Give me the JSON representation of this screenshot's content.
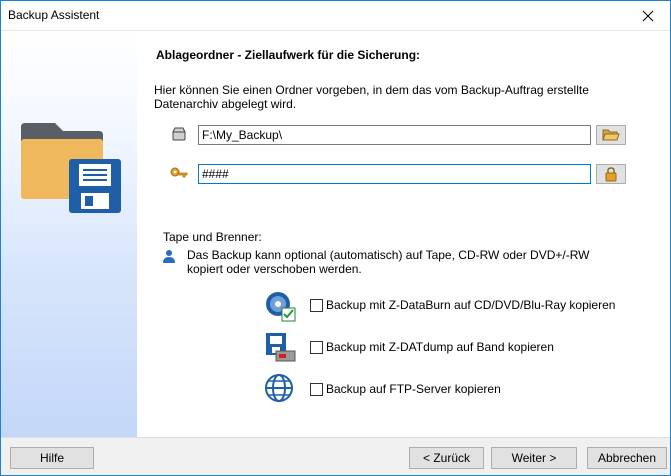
{
  "window": {
    "title": "Backup Assistent"
  },
  "heading": "Ablageordner - Ziellaufwerk für die Sicherung:",
  "intro": "Hier können Sie einen Ordner vorgeben, in dem das vom Backup-Auftrag erstellte Datenarchiv abgelegt wird.",
  "folder_field": {
    "value": "F:\\My_Backup\\"
  },
  "password_field": {
    "value": "####"
  },
  "tape": {
    "label": "Tape und Brenner:",
    "info": "Das Backup kann optional (automatisch) auf Tape, CD-RW oder DVD+/-RW kopiert oder verschoben werden."
  },
  "options": [
    {
      "label": "Backup mit Z-DataBurn auf CD/DVD/Blu-Ray kopieren",
      "checked": false,
      "icon": "disc-burn-icon"
    },
    {
      "label": "Backup mit Z-DATdump auf Band kopieren",
      "checked": false,
      "icon": "tape-drive-icon"
    },
    {
      "label": "Backup auf FTP-Server kopieren",
      "checked": false,
      "icon": "globe-icon"
    }
  ],
  "buttons": {
    "help": "Hilfe",
    "back": "< Zurück",
    "next": "Weiter >",
    "cancel": "Abbrechen"
  },
  "colors": {
    "accent": "#0078d7",
    "folder": "#f0b85c",
    "floppy": "#1f5fa8"
  }
}
